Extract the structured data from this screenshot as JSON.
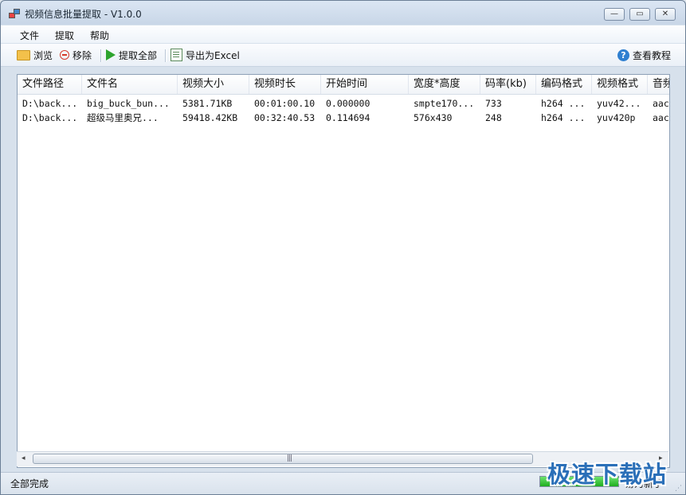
{
  "window": {
    "title": "视频信息批量提取 - V1.0.0"
  },
  "window_buttons": {
    "minimize": "—",
    "maximize": "▭",
    "close": "✕"
  },
  "menu": {
    "file": "文件",
    "extract": "提取",
    "help": "帮助"
  },
  "toolbar": {
    "browse": "浏览",
    "remove": "移除",
    "extract_all": "提取全部",
    "export_excel": "导出为Excel",
    "tutorial": "查看教程",
    "help_icon_glyph": "?"
  },
  "table": {
    "columns": [
      "文件路径",
      "文件名",
      "视频大小",
      "视频时长",
      "开始时间",
      "宽度*高度",
      "码率(kb)",
      "编码格式",
      "视频格式",
      "音频"
    ],
    "rows": [
      [
        "D:\\back...",
        "big_buck_bun...",
        "5381.71KB",
        "00:01:00.10",
        "0.000000",
        "smpte170...",
        "733",
        "h264 ...",
        "yuv42...",
        "aac"
      ],
      [
        "D:\\back...",
        "超级马里奥兄...",
        "59418.42KB",
        "00:32:40.53",
        "0.114694",
        "576x430",
        "248",
        "h264 ...",
        "yuv420p",
        "aac"
      ]
    ]
  },
  "scrollbar": {
    "left_arrow": "◂",
    "right_arrow": "▸",
    "grip": "|||"
  },
  "status": {
    "text": "全部完成",
    "right_text": "易为新手",
    "progress": 1.0
  },
  "watermark": "极速下载站",
  "colors": {
    "accent": "#2f7fd0",
    "progress": "#1fae1f",
    "remove": "#d63a2a",
    "extract": "#2ea42e"
  }
}
